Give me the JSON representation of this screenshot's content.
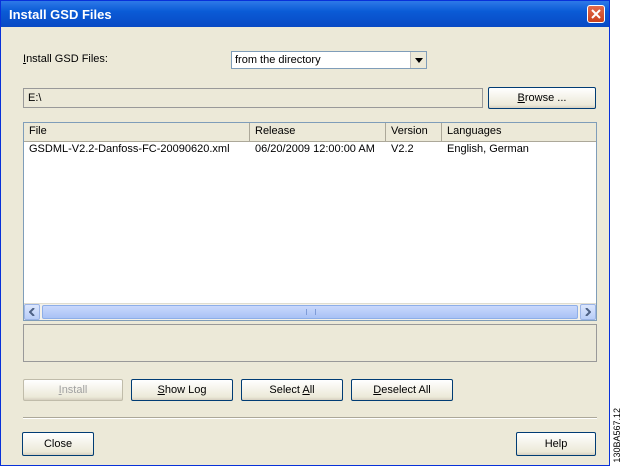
{
  "window": {
    "title": "Install GSD Files"
  },
  "source": {
    "label_accel": "I",
    "label_rest": "nstall GSD Files:",
    "selected_option": "from the directory"
  },
  "path": {
    "value": "E:\\"
  },
  "browse": {
    "accel": "B",
    "rest": "rowse ..."
  },
  "list": {
    "columns": [
      "File",
      "Release",
      "Version",
      "Languages"
    ],
    "rows": [
      {
        "file": "GSDML-V2.2-Danfoss-FC-20090620.xml",
        "release": "06/20/2009 12:00:00 AM",
        "version": "V2.2",
        "languages": "English, German"
      }
    ]
  },
  "actions": {
    "install": {
      "accel": "I",
      "rest": "nstall",
      "enabled": false
    },
    "show_log": {
      "accel": "S",
      "rest": "how Log"
    },
    "select_all": {
      "prefix": "Select ",
      "accel": "A",
      "rest": "ll"
    },
    "deselect_all": {
      "accel": "D",
      "rest": "eselect All"
    }
  },
  "footer": {
    "close_label": "Close",
    "help_label": "Help"
  },
  "figure_id": "130BA567.12"
}
